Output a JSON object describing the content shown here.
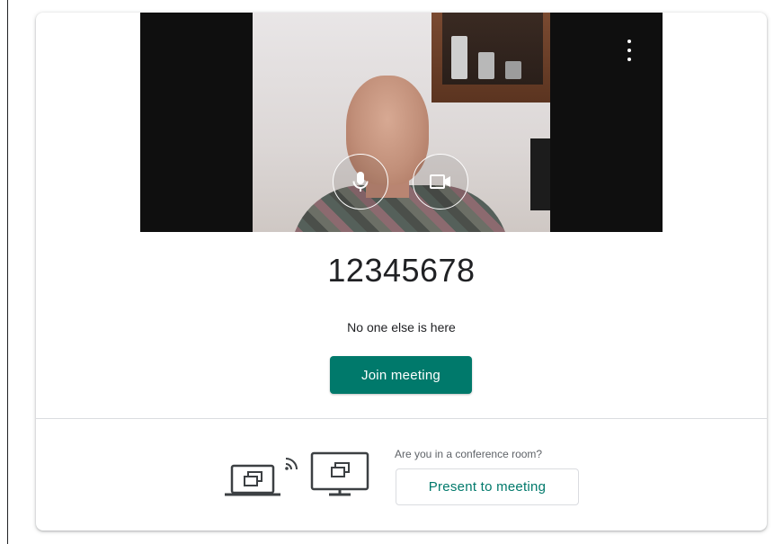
{
  "preview": {
    "menu_icon": "more-vert-icon",
    "mic_icon": "microphone-icon",
    "camera_icon": "videocam-icon"
  },
  "meeting": {
    "code": "12345678",
    "status": "No one else is here",
    "join_label": "Join meeting"
  },
  "conference": {
    "question": "Are you in a conference room?",
    "present_label": "Present to meeting",
    "illustration_icons": [
      "laptop-present-icon",
      "cast-signal-icon",
      "monitor-present-icon"
    ]
  },
  "colors": {
    "accent": "#00796b",
    "text_primary": "#202124",
    "text_secondary": "#5f6368",
    "divider": "#dadce0"
  }
}
